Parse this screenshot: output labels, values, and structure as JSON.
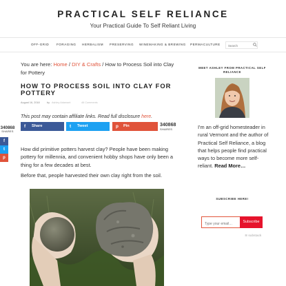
{
  "site": {
    "title": "PRACTICAL SELF RELIANCE",
    "tagline": "Your Practical Guide To Self Reliant Living"
  },
  "nav": {
    "items": [
      "OFF-GRID",
      "FORAGING",
      "HERBALISM",
      "PRESERVING",
      "WINEMAKING & BREWING",
      "PERMACULTURE"
    ],
    "search_placeholder": "Search"
  },
  "breadcrumb": {
    "prefix": "You are here:",
    "home": "Home",
    "sep": "/",
    "category": "DIY & Crafts",
    "current": "How to Process Soil into Clay for Pottery"
  },
  "post": {
    "title": "HOW TO PROCESS SOIL INTO CLAY FOR POTTERY",
    "date": "August 16, 2018",
    "by": "by",
    "author": "Ashley Adamant",
    "comments": "46 Comments",
    "disclosure_text": "This post may contain affiliate links.  Read full disclosure",
    "disclosure_link": "here",
    "disclosure_end": ".",
    "paragraph1": "How did primitive potters harvest clay?  People have been making pottery for millennia, and convenient hobby shops have only been a thing for a few decades at best.",
    "paragraph2": "Before that, people harvested their own clay right from the soil."
  },
  "share": {
    "count": "340868",
    "label": "SHARES",
    "facebook": "Share",
    "twitter": "Tweet",
    "pinterest": "Pin",
    "side_f": "f",
    "side_t": "t",
    "side_p": "p",
    "colors": {
      "facebook": "#3b5998",
      "twitter": "#1da1f2",
      "pinterest": "#e0533a"
    }
  },
  "sidebar": {
    "meet_heading": "MEET ASHLEY FROM PRACTICAL SELF RELIANCE",
    "about": "I'm an off-grid homesteader in rural Vermont and the author of Practical Self Reliance, a blog that helps people find practical ways to become more self-reliant.",
    "read_more": "Read More…",
    "subscribe_heading": "SUBSCRIBE HERE!",
    "email_placeholder": "Type your email…",
    "subscribe_button": "Subscribe",
    "substack": "substack"
  },
  "colors": {
    "accent": "#e0533a",
    "subscribe": "#e6132c"
  }
}
